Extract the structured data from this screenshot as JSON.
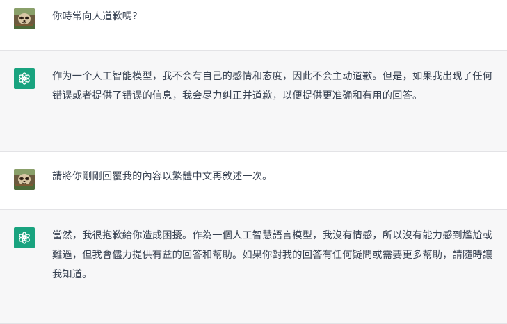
{
  "conversation": {
    "messages": [
      {
        "role": "user",
        "avatar_icon": "user-avatar-sloth",
        "text": "你時常向人道歉嗎？"
      },
      {
        "role": "assistant",
        "avatar_icon": "openai-logo-icon",
        "text": "作为一个人工智能模型，我不会有自己的感情和态度，因此不会主动道歉。但是，如果我出现了任何错误或者提供了错误的信息，我会尽力纠正并道歉，以便提供更准确和有用的回答。"
      },
      {
        "role": "user",
        "avatar_icon": "user-avatar-sloth",
        "text": "請將你剛剛回覆我的內容以繁體中文再敘述一次。"
      },
      {
        "role": "assistant",
        "avatar_icon": "openai-logo-icon",
        "text": "當然，我很抱歉給你造成困擾。作為一個人工智慧語言模型，我沒有情感，所以沒有能力感到尷尬或難過，但我會儘力提供有益的回答和幫助。如果你對我的回答有任何疑問或需要更多幫助，請隨時讓我知道。"
      }
    ]
  },
  "colors": {
    "assistant_bg": "#f7f7f8",
    "user_bg": "#ffffff",
    "openai_green": "#19a37f",
    "text": "#374151",
    "divider": "#e3e3e6"
  }
}
